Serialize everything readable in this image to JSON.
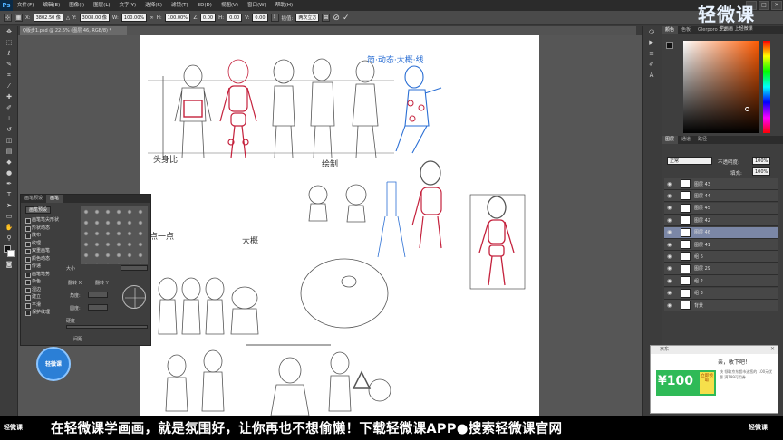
{
  "app": {
    "logo": "Ps",
    "menu": [
      "文件(F)",
      "编辑(E)",
      "图像(I)",
      "图层(L)",
      "文字(Y)",
      "选择(S)",
      "滤镜(T)",
      "3D(D)",
      "视图(V)",
      "窗口(W)",
      "帮助(H)"
    ],
    "window_controls": [
      "—",
      "□",
      "✕"
    ]
  },
  "options_bar": {
    "x_label": "X:",
    "x_value": "3802.50 像",
    "y_label": "Y:",
    "y_value": "3008.00 像",
    "w_label": "W:",
    "w_value": "100.00%",
    "h_label": "H:",
    "h_value": "100.00%",
    "rot_value": "0.00",
    "hskew_label": "H:",
    "hskew_value": "0.00",
    "vskew_label": "V:",
    "vskew_value": "0.00",
    "interp_label": "插值:",
    "interp_value": "两次立方",
    "cancel_glyph": "⊘",
    "commit_glyph": "✓"
  },
  "document": {
    "tab_label": "Q版步1.psd @ 22.6% (图层 46, RGB/8) *"
  },
  "brush_panel": {
    "tabs": [
      "画笔预设",
      "画笔"
    ],
    "preset_button": "画笔预设",
    "options": [
      "画笔笔尖形状",
      "形状动态",
      "散布",
      "纹理",
      "双重画笔",
      "颜色动态",
      "传递",
      "画笔笔势",
      "杂色",
      "湿边",
      "建立",
      "平滑",
      "保护纹理"
    ],
    "size_label": "大小",
    "flipx_label": "翻转 X",
    "flipy_label": "翻转 Y",
    "angle_label": "角度:",
    "roundness_label": "圆度:",
    "hardness_label": "硬度",
    "spacing_label": "间距"
  },
  "right_panel": {
    "color_tabs": [
      "颜色",
      "色板",
      "Glerporo 2.2"
    ],
    "layers_tabs": [
      "图层",
      "通道",
      "路径"
    ],
    "blend_mode": "正常",
    "opacity_label": "不透明度:",
    "opacity_value": "100%",
    "fill_label": "填充:",
    "fill_value": "100%",
    "layers": [
      {
        "name": "图层 43",
        "selected": false
      },
      {
        "name": "图层 44",
        "selected": false
      },
      {
        "name": "图层 45",
        "selected": false
      },
      {
        "name": "图层 42",
        "selected": false
      },
      {
        "name": "图层 46",
        "selected": true
      },
      {
        "name": "图层 41",
        "selected": false
      },
      {
        "name": "组 6",
        "selected": false
      },
      {
        "name": "图层 29",
        "selected": false
      },
      {
        "name": "组 2",
        "selected": false
      },
      {
        "name": "组 3",
        "selected": false
      },
      {
        "name": "背景",
        "selected": false
      }
    ]
  },
  "ad": {
    "title": "京东",
    "headline": "亲，收下吧！",
    "body": "快 领取京东超市送您的 100元优惠 满199可用券",
    "coupon_value": "¥100",
    "cta": "立即领取"
  },
  "canvas_text": [
    "简·动态·大概·线",
    "绘制",
    "头身比",
    "大概",
    "点一点"
  ],
  "brand": {
    "top_logo": "轻微课",
    "top_sub": "学画画 上轻微课",
    "circle_logo": "轻微课",
    "ticker_logo_left": "轻微课",
    "ticker_logo_right": "轻微课",
    "ticker": "在轻微课学画画，就是氛围好，让你再也不想偷懒！下载轻微课APP●搜索轻微课官网"
  },
  "colors": {
    "accent": "#2b7fd6",
    "ps_blue": "#4fb0ff",
    "sketch_red": "#c4213c",
    "sketch_blue": "#2b6fd4",
    "ad_green": "#2fba57"
  }
}
